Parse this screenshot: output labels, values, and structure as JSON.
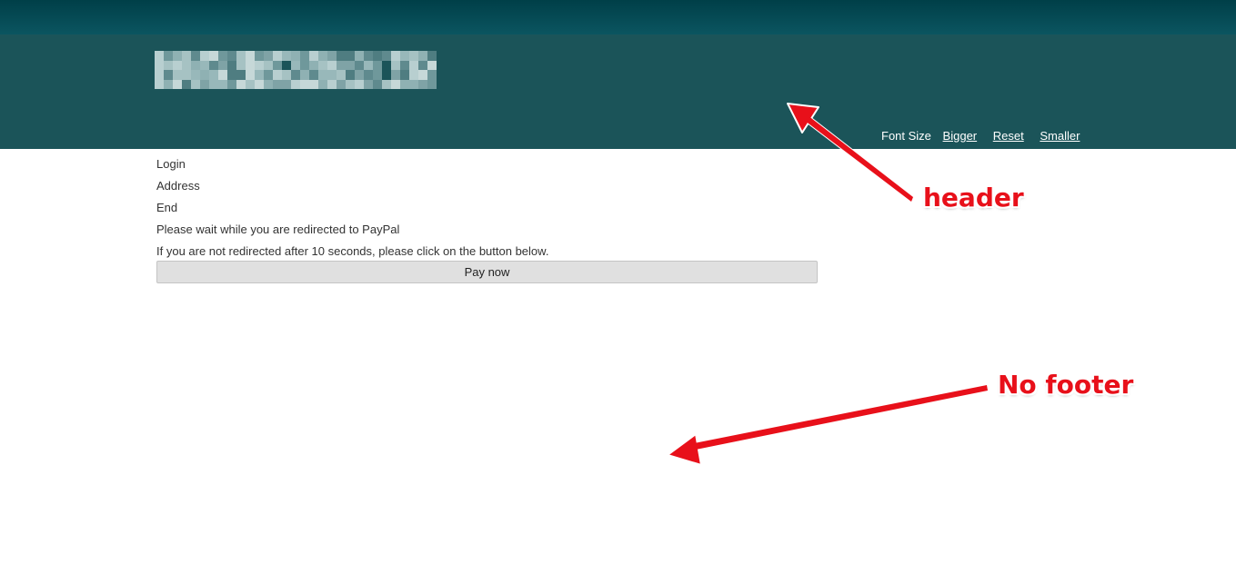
{
  "header": {
    "logo_alt": "site-logo-pixelated",
    "font_size": {
      "label": "Font Size",
      "bigger": "Bigger",
      "reset": "Reset",
      "smaller": "Smaller"
    }
  },
  "content": {
    "steps": [
      "Login",
      "Address",
      "End"
    ],
    "redirect_message": "Please wait while you are redirected to PayPal",
    "fallback_message": "If you are not redirected after 10 seconds, please click on the button below.",
    "pay_button_label": "Pay now"
  },
  "annotations": {
    "header_label": "header",
    "footer_label": "No footer"
  },
  "colors": {
    "header_background": "#1b5459",
    "top_bar": "#003f48",
    "annotation_red": "#e8101a",
    "button_background": "#e0e0e0"
  }
}
